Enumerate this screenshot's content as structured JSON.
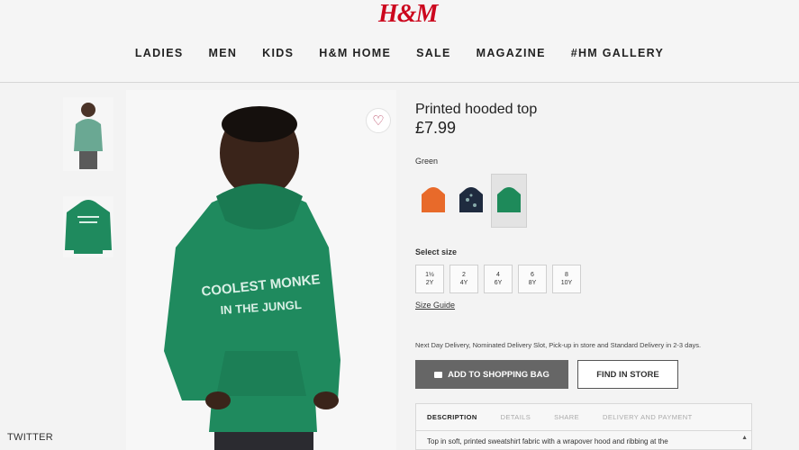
{
  "header": {
    "logo": "H&M",
    "nav": [
      "LADIES",
      "MEN",
      "KIDS",
      "H&M HOME",
      "SALE",
      "MAGAZINE",
      "#HM GALLERY"
    ]
  },
  "product": {
    "title": "Printed hooded top",
    "price": "£7.99",
    "color_label": "Green",
    "swatches": [
      {
        "color": "#e86a2a",
        "selected": false
      },
      {
        "color": "#1f2b3f",
        "selected": false
      },
      {
        "color": "#1e8a5a",
        "selected": true
      }
    ],
    "size_label": "Select size",
    "sizes": [
      "1½\n2Y",
      "2\n4Y",
      "4\n6Y",
      "6\n8Y",
      "8\n10Y"
    ],
    "size_guide": "Size Guide",
    "delivery_text": "Next Day Delivery, Nominated Delivery Slot, Pick-up in store and Standard Delivery in 2-3 days.",
    "add_to_bag": "ADD TO SHOPPING BAG",
    "find_in_store": "FIND IN STORE"
  },
  "tabs": {
    "items": [
      "DESCRIPTION",
      "DETAILS",
      "SHARE",
      "DELIVERY AND PAYMENT"
    ],
    "active": "DESCRIPTION",
    "description_text": "Top in soft, printed sweatshirt fabric with a wrapover hood and ribbing at the"
  },
  "hoodie_print": {
    "line1": "COOLEST MONKE",
    "line2": "IN THE JUNGL"
  },
  "watermark": "TWITTER",
  "colors": {
    "brand_red": "#cc071e",
    "hoodie_green": "#1f8a5e",
    "button_grey": "#666666"
  }
}
